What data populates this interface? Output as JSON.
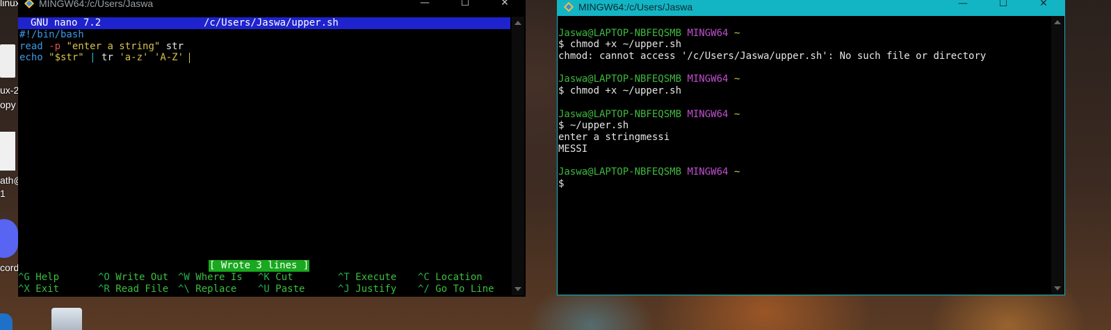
{
  "desktop": {
    "labels": [
      "linux",
      "ux-2",
      "opy",
      "ath@",
      "1",
      "cord"
    ]
  },
  "nano_window": {
    "title": "MINGW64:/c/Users/Jaswa",
    "header_left": "GNU nano 7.2",
    "header_path": "/c/Users/Jaswa/upper.sh",
    "lines": [
      [
        {
          "t": "#!/bin/bash",
          "c": "blue"
        }
      ],
      [
        {
          "t": "read",
          "c": "blue"
        },
        {
          "t": " ",
          "c": "white"
        },
        {
          "t": "-p",
          "c": "red"
        },
        {
          "t": " \"enter a string\"",
          "c": "yellow"
        },
        {
          "t": " str",
          "c": "white"
        }
      ],
      [
        {
          "t": "echo",
          "c": "blue"
        },
        {
          "t": " \"$str\"",
          "c": "yellow"
        },
        {
          "t": " ",
          "c": "white"
        },
        {
          "t": "|",
          "c": "cyan"
        },
        {
          "t": " tr ",
          "c": "white"
        },
        {
          "t": "'a-z' 'A-Z'",
          "c": "yellow"
        }
      ]
    ],
    "status_message": "[ Wrote 3 lines ]",
    "shortcuts_row1": [
      {
        "key": "^G",
        "label": "Help"
      },
      {
        "key": "^O",
        "label": "Write Out"
      },
      {
        "key": "^W",
        "label": "Where Is"
      },
      {
        "key": "^K",
        "label": "Cut"
      },
      {
        "key": "^T",
        "label": "Execute"
      },
      {
        "key": "^C",
        "label": "Location"
      }
    ],
    "shortcuts_row2": [
      {
        "key": "^X",
        "label": "Exit"
      },
      {
        "key": "^R",
        "label": "Read File"
      },
      {
        "key": "^\\",
        "label": "Replace"
      },
      {
        "key": "^U",
        "label": "Paste"
      },
      {
        "key": "^J",
        "label": "Justify"
      },
      {
        "key": "^/",
        "label": "Go To Line"
      }
    ]
  },
  "terminal_window": {
    "title": "MINGW64:/c/Users/Jaswa",
    "lines": [
      [],
      [
        {
          "t": "Jaswa@LAPTOP-NBFEQSMB",
          "c": "green"
        },
        {
          "t": " ",
          "c": "white"
        },
        {
          "t": "MINGW64",
          "c": "purple"
        },
        {
          "t": " ~",
          "c": "yellow"
        }
      ],
      [
        {
          "t": "$ chmod +x ~/upper.sh",
          "c": "white"
        }
      ],
      [
        {
          "t": "chmod: cannot access '/c/Users/Jaswa/upper.sh': No such file or directory",
          "c": "white"
        }
      ],
      [],
      [
        {
          "t": "Jaswa@LAPTOP-NBFEQSMB",
          "c": "green"
        },
        {
          "t": " ",
          "c": "white"
        },
        {
          "t": "MINGW64",
          "c": "purple"
        },
        {
          "t": " ~",
          "c": "yellow"
        }
      ],
      [
        {
          "t": "$ chmod +x ~/upper.sh",
          "c": "white"
        }
      ],
      [],
      [
        {
          "t": "Jaswa@LAPTOP-NBFEQSMB",
          "c": "green"
        },
        {
          "t": " ",
          "c": "white"
        },
        {
          "t": "MINGW64",
          "c": "purple"
        },
        {
          "t": " ~",
          "c": "yellow"
        }
      ],
      [
        {
          "t": "$ ~/upper.sh",
          "c": "white"
        }
      ],
      [
        {
          "t": "enter a stringmessi",
          "c": "white"
        }
      ],
      [
        {
          "t": "MESSI",
          "c": "white"
        }
      ],
      [],
      [
        {
          "t": "Jaswa@LAPTOP-NBFEQSMB",
          "c": "green"
        },
        {
          "t": " ",
          "c": "white"
        },
        {
          "t": "MINGW64",
          "c": "purple"
        },
        {
          "t": " ~",
          "c": "yellow"
        }
      ],
      [
        {
          "t": "$",
          "c": "white"
        }
      ]
    ]
  },
  "window_controls": {
    "minimize": "—",
    "maximize": "☐",
    "close": "✕"
  },
  "colors": {
    "nano_titlebar": "#000000",
    "terminal_titlebar": "#13b5c5",
    "nano_header_bg": "#1f23ce",
    "status_bg": "#19a81f",
    "shortcut_key": "#25b54a",
    "shortcut_label": "#3dbf3d"
  }
}
